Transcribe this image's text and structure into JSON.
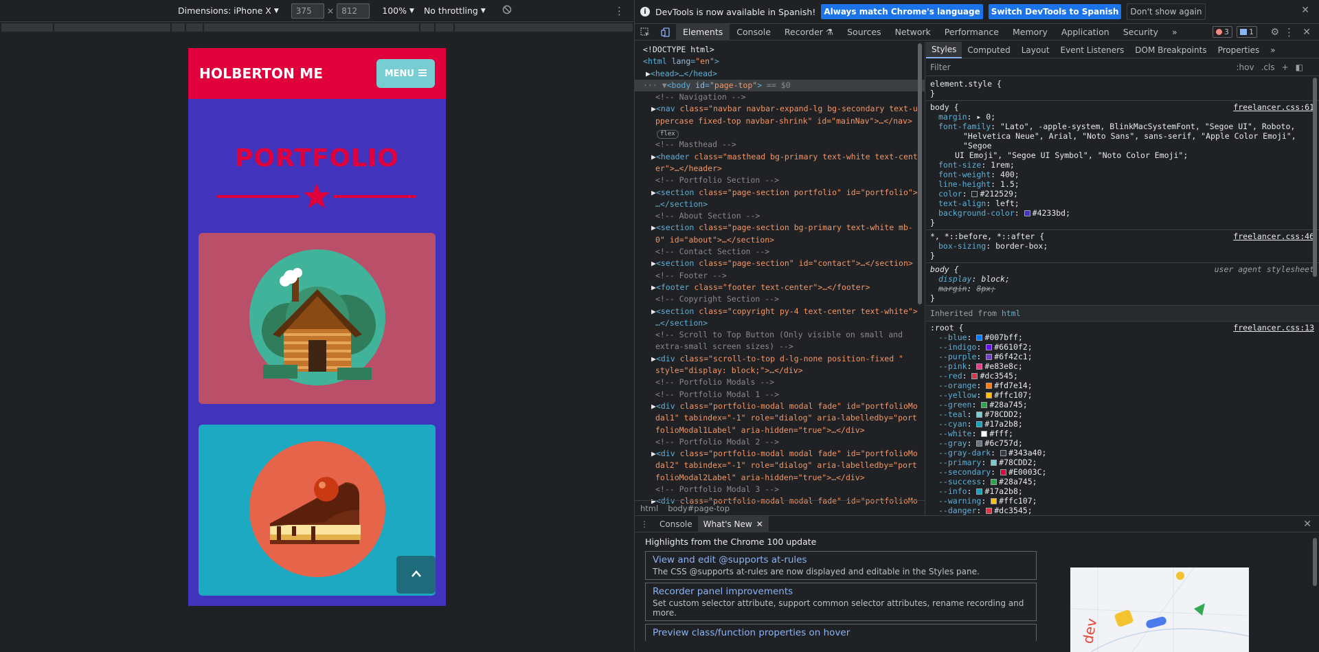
{
  "device_toolbar": {
    "device_label": "Dimensions: iPhone X",
    "width": "375",
    "times": "×",
    "height": "812",
    "zoom": "100%",
    "throttling": "No throttling"
  },
  "mobile_page": {
    "brand": "HOLBERTON ME",
    "menu_label": "MENU",
    "section_title": "PORTFOLIO",
    "colors": {
      "primary_bg": "#4233bd",
      "nav_bg": "#e0003c",
      "menu_btn": "#78cdd2",
      "card1": "#b94f69",
      "card2": "#1ea9c3"
    }
  },
  "infobar": {
    "message": "DevTools is now available in Spanish!",
    "btn_match": "Always match Chrome's language",
    "btn_switch": "Switch DevTools to Spanish",
    "btn_dismiss": "Don't show again"
  },
  "main_tabs": [
    "Elements",
    "Console",
    "Recorder",
    "Sources",
    "Network",
    "Performance",
    "Memory",
    "Application",
    "Security"
  ],
  "more_tabs": "»",
  "error_count": "3",
  "message_count": "1",
  "dom_tree": {
    "doctype": "<!DOCTYPE html>",
    "html_open": "html",
    "html_lang_attr": "lang",
    "html_lang_val": "\"en\"",
    "head": "<head>…</head>",
    "body_attr_val": "\"page-top\"",
    "body_suffix": " == $0",
    "c_nav": "<!-- Navigation -->",
    "nav_l1": "class=\"navbar navbar-expand-lg bg-secondary text-u",
    "nav_l2": "ppercase fixed-top navbar-shrink\" id=\"mainNav\">…</nav>",
    "nav_badge": "flex",
    "c_masthead": "<!-- Masthead -->",
    "header_l1": "class=\"masthead bg-primary text-white text-cent",
    "header_l2": "er\">…</header>",
    "c_portfolio": "<!-- Portfolio Section -->",
    "portfolio_l1": "class=\"page-section portfolio\" id=\"portfolio\">",
    "portfolio_l2": "…</section>",
    "c_about": "<!-- About Section -->",
    "about_l1": "class=\"page-section bg-primary text-white mb-",
    "about_l2": "0\" id=\"about\">…</section>",
    "c_contact": "<!-- Contact Section -->",
    "contact_l1": "class=\"page-section\" id=\"contact\">…</section>",
    "c_footer": "<!-- Footer -->",
    "footer_l1": "class=\"footer text-center\">…</footer>",
    "c_copyright": "<!-- Copyright Section -->",
    "copyright_l1": "class=\"copyright py-4 text-center text-white\">",
    "copyright_l2": "…</section>",
    "c_scroll1": "<!-- Scroll to Top Button (Only visible on small and",
    "c_scroll2": "extra-small screen sizes) -->",
    "scroll_l1": "class=\"scroll-to-top d-lg-none position-fixed \"",
    "scroll_l2": "style=\"display: block;\">…</div>",
    "c_modals": "<!-- Portfolio Modals -->",
    "c_modal1": "<!-- Portfolio Modal 1 -->",
    "modal1_l1": "class=\"portfolio-modal modal fade\" id=\"portfolioMo",
    "modal1_l2": "dal1\" tabindex=\"-1\" role=\"dialog\" aria-labelledby=\"port",
    "modal1_l3": "folioModal1Label\" aria-hidden=\"true\">…</div>",
    "c_modal2": "<!-- Portfolio Modal 2 -->",
    "modal2_l1": "class=\"portfolio-modal modal fade\" id=\"portfolioMo",
    "modal2_l2": "dal2\" tabindex=\"-1\" role=\"dialog\" aria-labelledby=\"port",
    "modal2_l3": "folioModal2Label\" aria-hidden=\"true\">…</div>",
    "c_modal3": "<!-- Portfolio Modal 3 -->",
    "modal3_l1": "class=\"portfolio-modal modal fade\" id=\"portfolioMo"
  },
  "breadcrumbs": [
    "html",
    "body#page-top"
  ],
  "styles_tabs": [
    "Styles",
    "Computed",
    "Layout",
    "Event Listeners",
    "DOM Breakpoints",
    "Properties"
  ],
  "styles_filter": {
    "placeholder": "Filter",
    "hov": ":hov",
    "cls": ".cls",
    "plus": "+"
  },
  "styles": {
    "element_style": "element.style {",
    "body_src": "freelancer.css:61",
    "body_font_l1": "\"Lato\", -apple-system, BlinkMacSystemFont, \"Segoe UI\", Roboto,",
    "body_font_l2": "\"Helvetica Neue\", Arial, \"Noto Sans\", sans-serif, \"Apple Color Emoji\", \"Segoe",
    "body_font_l3": "UI Emoji\", \"Segoe UI Symbol\", \"Noto Color Emoji\";",
    "universal_src": "freelancer.css:46",
    "ua_label": "user agent stylesheet",
    "inherited_from": "Inherited from",
    "inherited_tag": "html",
    "root_src": "freelancer.css:13",
    "root_vars": [
      {
        "name": "--blue",
        "value": "#007bff"
      },
      {
        "name": "--indigo",
        "value": "#6610f2"
      },
      {
        "name": "--purple",
        "value": "#6f42c1"
      },
      {
        "name": "--pink",
        "value": "#e83e8c"
      },
      {
        "name": "--red",
        "value": "#dc3545"
      },
      {
        "name": "--orange",
        "value": "#fd7e14"
      },
      {
        "name": "--yellow",
        "value": "#ffc107"
      },
      {
        "name": "--green",
        "value": "#28a745"
      },
      {
        "name": "--teal",
        "value": "#78CDD2"
      },
      {
        "name": "--cyan",
        "value": "#17a2b8"
      },
      {
        "name": "--white",
        "value": "#fff"
      },
      {
        "name": "--gray",
        "value": "#6c757d"
      },
      {
        "name": "--gray-dark",
        "value": "#343a40"
      },
      {
        "name": "--primary",
        "value": "#78CDD2"
      },
      {
        "name": "--secondary",
        "value": "#E0003C"
      },
      {
        "name": "--success",
        "value": "#28a745"
      },
      {
        "name": "--info",
        "value": "#17a2b8"
      },
      {
        "name": "--warning",
        "value": "#ffc107"
      },
      {
        "name": "--danger",
        "value": "#dc3545"
      }
    ]
  },
  "drawer": {
    "tabs": [
      "Console",
      "What's New"
    ],
    "heading": "Highlights from the Chrome 100 update",
    "features": [
      {
        "title": "View and edit @supports at-rules",
        "desc": "The CSS @supports at-rules are now displayed and editable in the Styles pane."
      },
      {
        "title": "Recorder panel improvements",
        "desc": "Set custom selector attribute, support common selector attributes, rename recording and more."
      },
      {
        "title": "Preview class/function properties on hover",
        "desc": ""
      }
    ]
  }
}
